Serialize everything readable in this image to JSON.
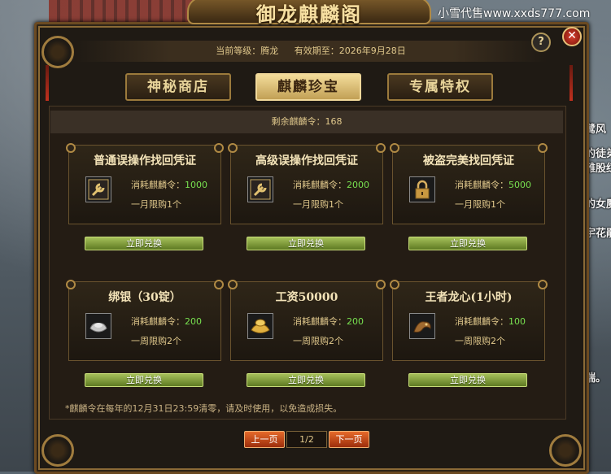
{
  "window": {
    "title": "御龙麒麟阁"
  },
  "watermark": "小雪代售www.xxds777.com",
  "side_texts": [
    "鹭风",
    "的徒弟",
    "雅股红",
    "的女魔",
    "宇花鹃",
    "瑞。"
  ],
  "header": {
    "level_label": "当前等级：",
    "level_value": "腾龙",
    "expiry_label": "有效期至：",
    "expiry_value": "2026年9月28日",
    "help_label": "?",
    "close_label": "✕"
  },
  "tabs": [
    {
      "label": "神秘商店",
      "active": false
    },
    {
      "label": "麒麟珍宝",
      "active": true
    },
    {
      "label": "专属特权",
      "active": false
    }
  ],
  "remaining": {
    "label": "剩余麒麟令：",
    "value": "168"
  },
  "items": [
    {
      "title": "普通误操作找回凭证",
      "icon": "wrench-icon",
      "cost_label": "消耗麒麟令：",
      "cost": "1000",
      "limit": "一月限购1个",
      "button": "立即兑换"
    },
    {
      "title": "高级误操作找回凭证",
      "icon": "wrench-icon",
      "cost_label": "消耗麒麟令：",
      "cost": "2000",
      "limit": "一月限购1个",
      "button": "立即兑换"
    },
    {
      "title": "被盗完美找回凭证",
      "icon": "padlock-icon",
      "cost_label": "消耗麒麟令：",
      "cost": "5000",
      "limit": "一月限购1个",
      "button": "立即兑换"
    },
    {
      "title": "绑银（30锭）",
      "icon": "silver-ingot-icon",
      "cost_label": "消耗麒麟令：",
      "cost": "200",
      "limit": "一周限购2个",
      "button": "立即兑换"
    },
    {
      "title": "工资50000",
      "icon": "gold-ingot-icon",
      "cost_label": "消耗麒麟令：",
      "cost": "200",
      "limit": "一周限购2个",
      "button": "立即兑换"
    },
    {
      "title": "王者龙心(1小时)",
      "icon": "dragon-heart-icon",
      "cost_label": "消耗麒麟令：",
      "cost": "100",
      "limit": "一周限购2个",
      "button": "立即兑换"
    }
  ],
  "note": "*麒麟令在每年的12月31日23:59清零，请及时使用，以免造成损失。",
  "pagination": {
    "prev": "上一页",
    "page": "1/2",
    "next": "下一页"
  },
  "colors": {
    "accent_gold": "#e0c88c",
    "cost_green": "#78e050",
    "button_green": "#7a9a34",
    "page_button_orange": "#d25520"
  }
}
